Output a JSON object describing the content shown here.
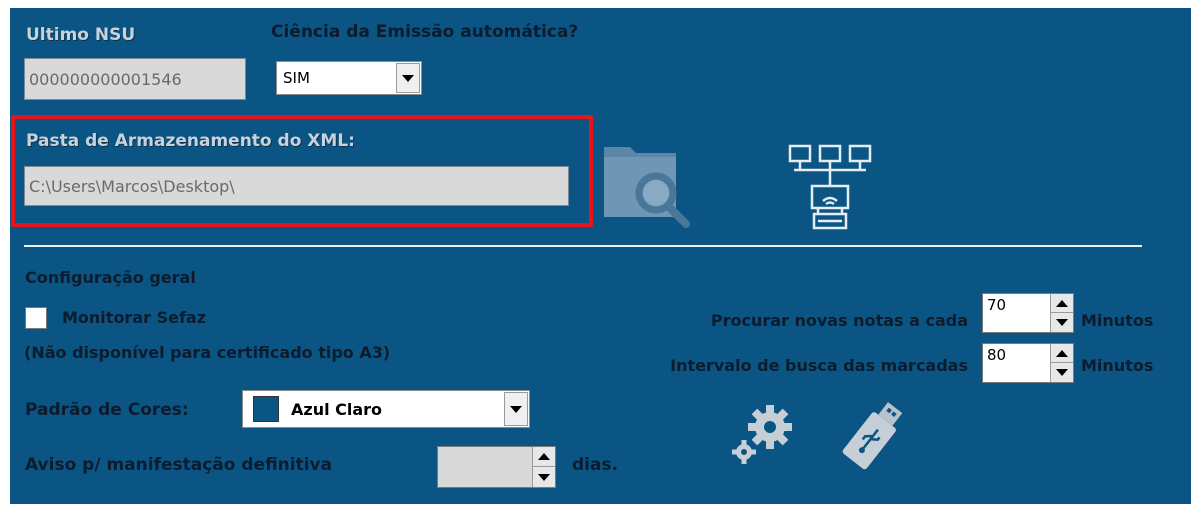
{
  "nsu": {
    "label": "Ultimo NSU",
    "value": "000000000001546"
  },
  "ciencia": {
    "label": "Ciência da Emissão automática?",
    "value": "SIM"
  },
  "xml_folder": {
    "label": "Pasta de Armazenamento do XML:",
    "path": "C:\\Users\\Marcos\\Desktop\\"
  },
  "general": {
    "title": "Configuração  geral",
    "monitor_label": "Monitorar Sefaz",
    "monitor_checked": false,
    "monitor_note": "(Não disponível para certificado tipo A3)"
  },
  "search": {
    "new_notes_label": "Procurar novas notas a cada",
    "new_notes_value": "70",
    "new_notes_unit": "Minutos",
    "interval_label": "Intervalo de busca das marcadas",
    "interval_value": "80",
    "interval_unit": "Minutos"
  },
  "colors": {
    "label": "Padrão de Cores:",
    "value": "Azul Claro",
    "swatch": "#0b5585"
  },
  "aviso": {
    "label": "Aviso p/ manifestação definitiva",
    "value": "",
    "unit": "dias."
  },
  "icons": {
    "folder_search": "folder-search-icon",
    "network": "network-icon",
    "gears": "gears-icon",
    "usb": "usb-drive-icon"
  },
  "theme": {
    "panel": "#0b5585",
    "highlight_border": "#e8141c"
  }
}
